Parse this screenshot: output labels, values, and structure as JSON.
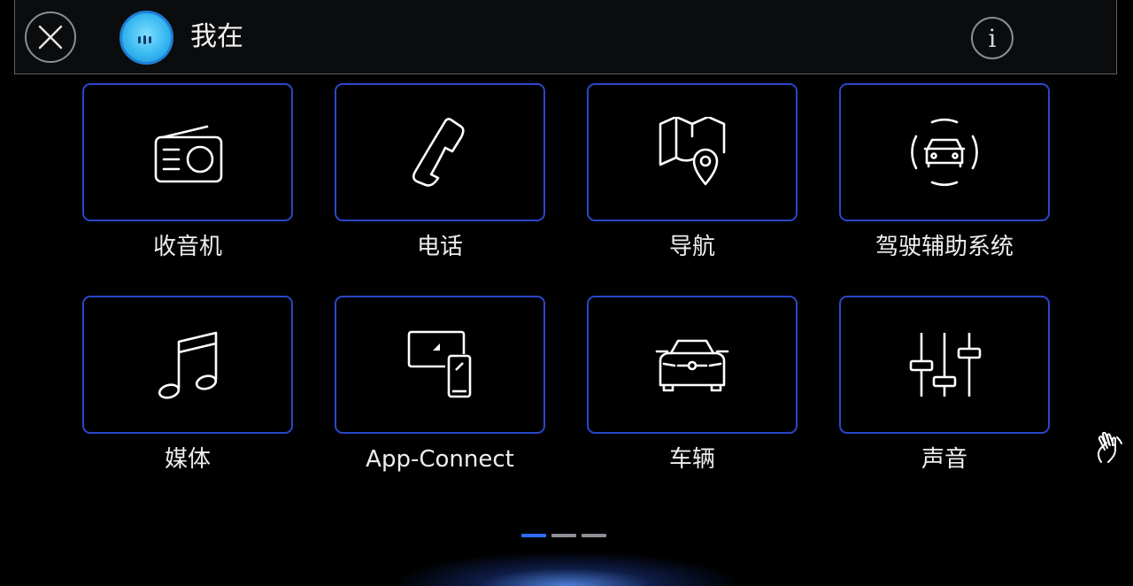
{
  "header": {
    "title": "我在",
    "close_icon": "close-icon",
    "info_icon": "info-icon",
    "info_glyph": "i",
    "assistant_icon": "voice-assistant-avatar"
  },
  "menu": {
    "items": [
      {
        "label": "收音机",
        "icon": "radio-icon"
      },
      {
        "label": "电话",
        "icon": "phone-icon"
      },
      {
        "label": "导航",
        "icon": "map-pin-icon"
      },
      {
        "label": "驾驶辅助系统",
        "icon": "driver-assist-icon"
      },
      {
        "label": "媒体",
        "icon": "music-note-icon"
      },
      {
        "label": "App-Connect",
        "icon": "app-connect-icon"
      },
      {
        "label": "车辆",
        "icon": "car-icon"
      },
      {
        "label": "声音",
        "icon": "equalizer-icon"
      }
    ]
  },
  "pager": {
    "pages": 3,
    "active": 1
  },
  "gesture_icon": "hand-gesture-icon",
  "colors": {
    "tile_border": "#2a47c9",
    "pager_active": "#2f6cf5",
    "pager_inactive": "#8c8f95",
    "avatar": "#38b8f0"
  }
}
